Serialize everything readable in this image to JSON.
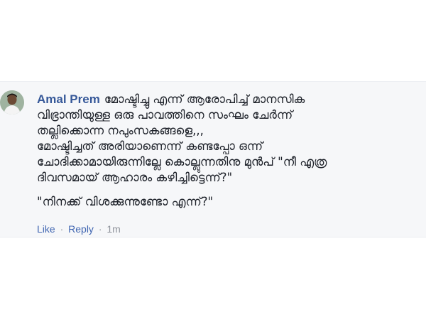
{
  "comment": {
    "author": "Amal Prem",
    "lines": [
      "മോഷ്ടിച്ചു എന്ന് ആരോപിച്ച് മാനസിക",
      "വിഭ്രാന്തിയുള്ള ഒരു പാവത്തിനെ സംഘം ചേർന്ന്",
      "തല്ലിക്കൊന്ന നപുംസകങ്ങളെ,,,",
      "മോഷ്ടിച്ചത് അരിയാണെന്ന് കണ്ടപ്പോ ഒന്ന്",
      "ചോദിക്കാമായിരുന്നില്ലേ കൊല്ലുന്നതിനു മുൻപ് \"നീ എത്ര",
      "ദിവസമായ് ആഹാരം കഴിച്ചിട്ടെന്ന്?\""
    ],
    "quote": "\"നിനക്ക് വിശക്കുന്നുണ്ടോ എന്ന്?\""
  },
  "actions": {
    "like": "Like",
    "separator": "·",
    "reply": "Reply",
    "time": "1m"
  },
  "icons": {
    "avatar": "user-avatar-photo"
  },
  "colors": {
    "author": "#365899",
    "link": "#4267b2",
    "meta": "#90949c",
    "background": "#f6f7f9"
  }
}
